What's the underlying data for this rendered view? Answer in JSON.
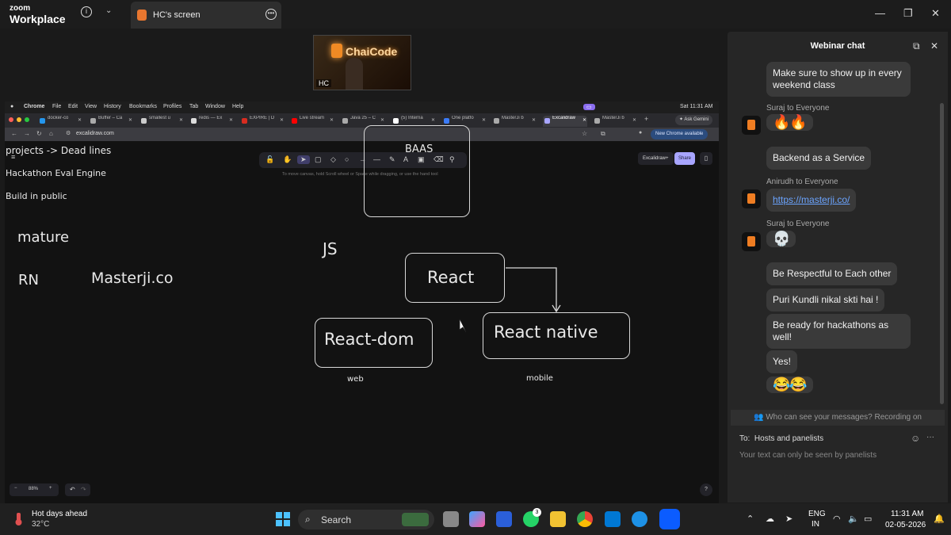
{
  "zoom": {
    "brand_line1": "zoom",
    "brand_line2": "Workplace",
    "share_tab": "HC's screen",
    "video_logo": "ChaiCode",
    "video_label": "HC"
  },
  "mac": {
    "app": "Chrome",
    "menu": [
      "File",
      "Edit",
      "View",
      "History",
      "Bookmarks",
      "Profiles",
      "Tab",
      "Window",
      "Help"
    ],
    "clock": "Sat 11:31 AM"
  },
  "browser": {
    "tabs": [
      "docker-co",
      "Buffer – Ca",
      "smallest u",
      "redis — Ex",
      "EXPIRE | D",
      "Live stream",
      "Java 25 – C",
      "(5) Interna",
      "One platfo",
      "MasterJi b",
      "Excalidraw",
      "MasterJi b"
    ],
    "ask_gemini": "Ask Gemini",
    "url": "excalidraw.com",
    "new_chrome": "New Chrome available"
  },
  "excalidraw": {
    "hint": "To move canvas, hold Scroll wheel or Space while dragging, or use the hand tool",
    "plus_label": "Excalidraw+",
    "share_label": "Share",
    "zoom_level": "88%",
    "texts": {
      "baas": "BAAS",
      "deadlines": "projects -> Dead lines",
      "hackathon": "Hackathon Eval Engine",
      "build": "Build in public",
      "mature": "mature",
      "rn": "RN",
      "masterji": "Masterji.co",
      "js": "JS",
      "react": "React",
      "react_dom": "React-dom",
      "react_native": "React native",
      "web": "web",
      "mobile": "mobile"
    }
  },
  "chat": {
    "title": "Webinar chat",
    "messages": [
      {
        "type": "text",
        "text": "Make sure to show up in every weekend class"
      },
      {
        "sender": "Suraj to Everyone",
        "type": "emoji",
        "text": "🔥🔥"
      },
      {
        "type": "text",
        "text": "Backend as a Service"
      },
      {
        "sender": "Anirudh to Everyone",
        "type": "link",
        "text": "https://masterji.co/"
      },
      {
        "sender": "Suraj to Everyone",
        "type": "emoji",
        "text": "💀"
      },
      {
        "type": "text",
        "text": "Be Respectful to Each other"
      },
      {
        "type": "text",
        "text": "Puri Kundli nikal skti hai !"
      },
      {
        "type": "text",
        "text": "Be ready for hackathons as well!"
      },
      {
        "type": "text",
        "text": "Yes!"
      },
      {
        "type": "emoji",
        "text": "😂😂"
      }
    ],
    "recording_note": "Who can see your messages? Recording on",
    "to_label": "To:",
    "to_value": "Hosts and panelists",
    "compose_placeholder": "Your text can only be seen by panelists"
  },
  "taskbar": {
    "weather_title": "Hot days ahead",
    "weather_temp": "32°C",
    "search_label": "Search",
    "whatsapp_badge": "3",
    "lang1": "ENG",
    "lang2": "IN",
    "time": "11:31 AM",
    "date": "02-05-2026"
  },
  "colors": {
    "accent": "#a8a5ff",
    "chat_bg": "#262626",
    "link": "#6ba4ff",
    "zoom_blue": "#0b5cff"
  }
}
